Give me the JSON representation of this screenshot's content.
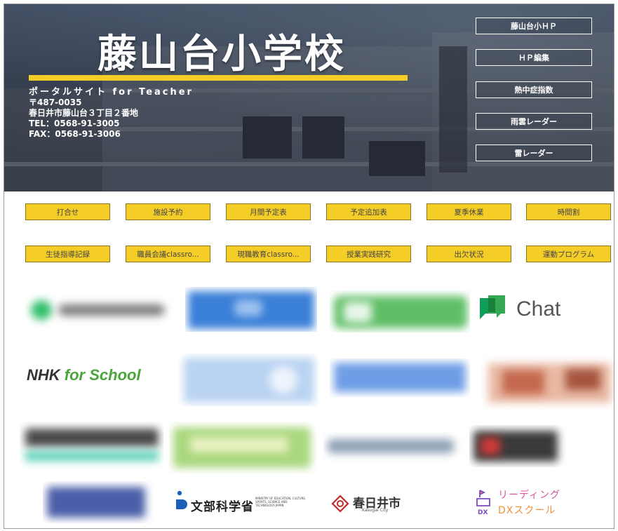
{
  "header": {
    "school_name": "藤山台小学校",
    "portal": "ポータルサイト for Teacher",
    "postal": "〒487-0035",
    "address": "春日井市藤山台３丁目２番地",
    "tel": "TEL：0568-91-3005",
    "fax": "FAX：0568-91-3006",
    "links": [
      "藤山台小ＨＰ",
      "ＨＰ編集",
      "熱中症指数",
      "雨雲レーダー",
      "雷レーダー"
    ]
  },
  "row1": [
    "打合せ",
    "施設予約",
    "月間予定表",
    "予定追加表",
    "夏季休業",
    "時間割"
  ],
  "row2": [
    "生徒指導記録",
    "職員会議classro...",
    "現職教育classro...",
    "授業実践研究",
    "出欠状況",
    "運動プログラム"
  ],
  "logos": {
    "chat": "Chat",
    "nhk_a": "NHK",
    "nhk_b": "for School",
    "mext": "文部科学省",
    "mext_en": "MINISTRY OF EDUCATION, CULTURE, SPORTS, SCIENCE AND TECHNOLOGY-JAPAN",
    "kasugai": "春日井市",
    "kasugai_en": "Kasugai City",
    "leading_a": "リーディング",
    "leading_b": "DXスクール"
  },
  "colors": {
    "accent": "#f5cd27"
  }
}
